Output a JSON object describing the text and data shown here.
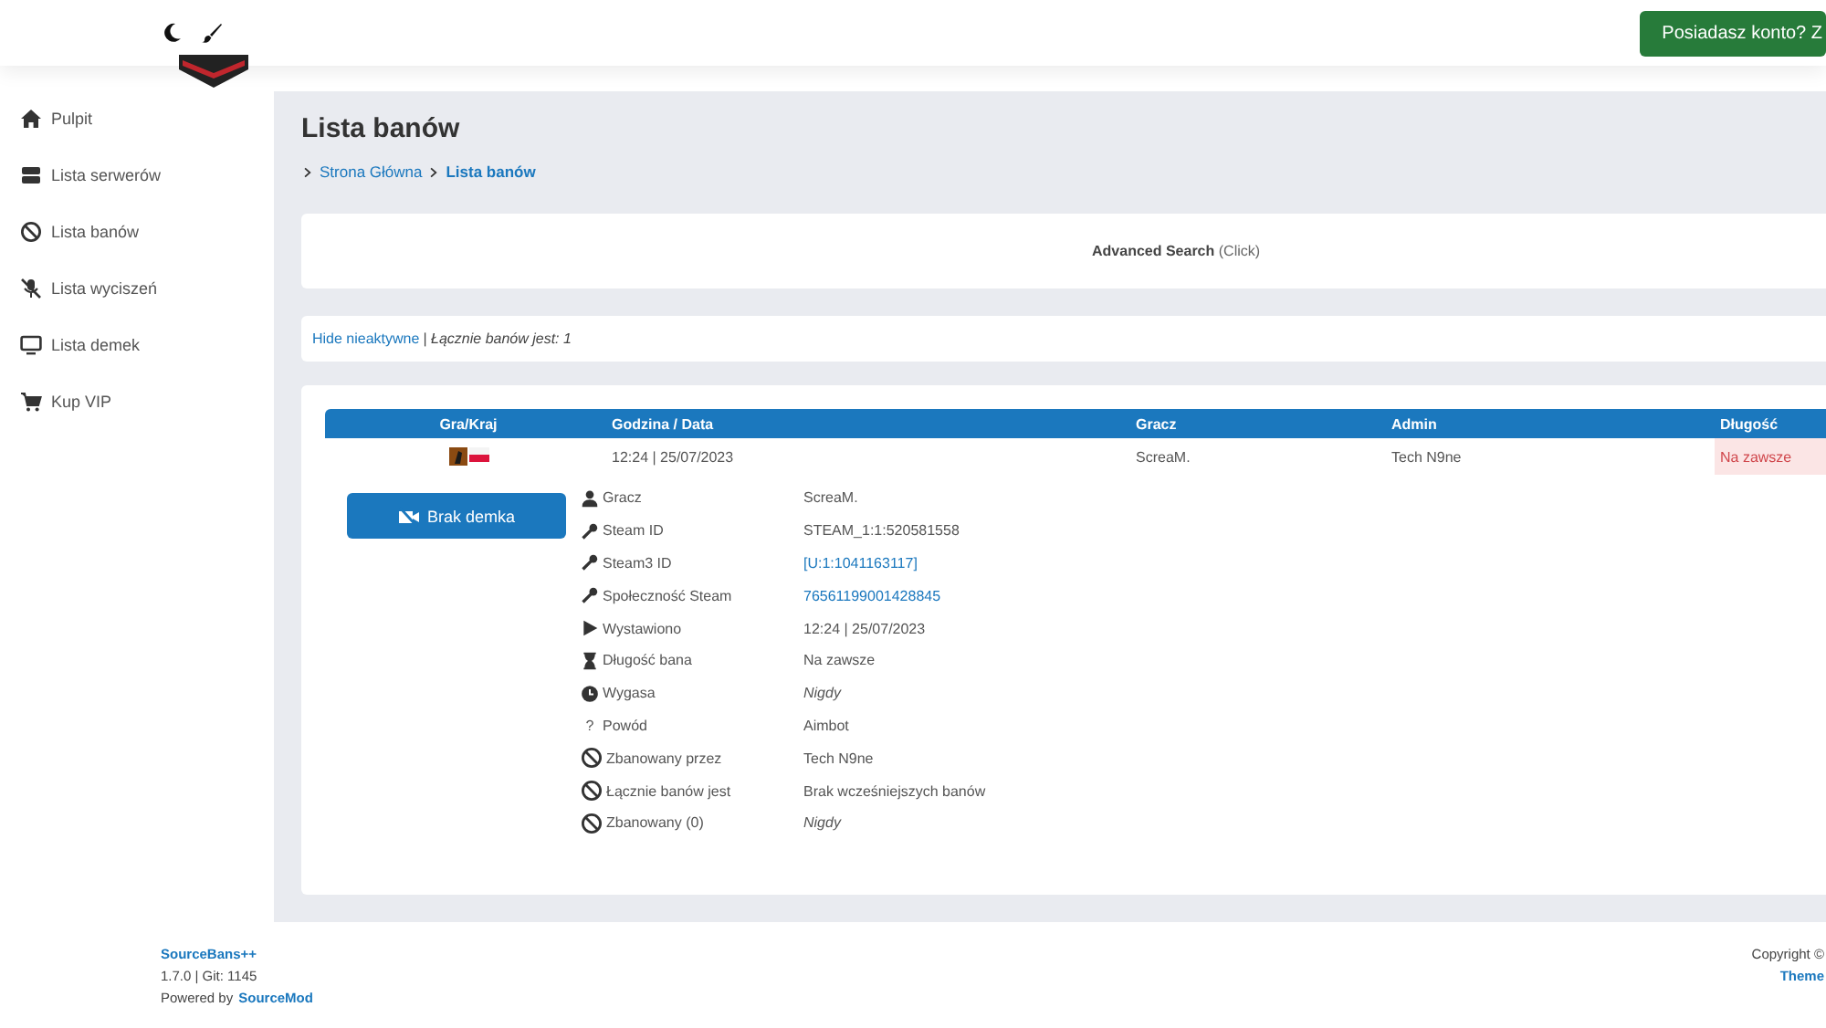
{
  "header": {
    "login_button": "Posiadasz konto? Z"
  },
  "sidebar": {
    "items": [
      {
        "label": "Pulpit"
      },
      {
        "label": "Lista serwerów"
      },
      {
        "label": "Lista banów"
      },
      {
        "label": "Lista wyciszeń"
      },
      {
        "label": "Lista demek"
      },
      {
        "label": "Kup VIP"
      }
    ]
  },
  "page_title": "Lista banów",
  "breadcrumb": [
    {
      "label": "Strona Główna",
      "current": false
    },
    {
      "label": "Lista banów",
      "current": true
    }
  ],
  "advanced_search": {
    "title": "Advanced Search",
    "hint": "(Click)"
  },
  "filter": {
    "link": "Hide nieaktywne",
    "separator": "|",
    "summary": "Łącznie banów jest: 1"
  },
  "table": {
    "columns": [
      "Gra/Kraj",
      "Godzina / Data",
      "Gracz",
      "Admin",
      "Długość"
    ],
    "rows": [
      {
        "time": "12:24 | 25/07/2023",
        "player": "ScreaM.",
        "admin": "Tech N9ne",
        "length": "Na zawsze",
        "expanded": true,
        "details": {
          "demo_button": "Brak demka",
          "fields": [
            {
              "label": "Gracz",
              "value": "ScreaM.",
              "kind": "text"
            },
            {
              "label": "Steam ID",
              "value": "STEAM_1:1:520581558",
              "kind": "text"
            },
            {
              "label": "Steam3 ID",
              "value": "[U:1:1041163117]",
              "kind": "link"
            },
            {
              "label": "Społeczność Steam",
              "value": "76561199001428845",
              "kind": "link"
            },
            {
              "label": "Wystawiono",
              "value": "12:24 | 25/07/2023",
              "kind": "text"
            },
            {
              "label": "Długość bana",
              "value": "Na zawsze",
              "kind": "text"
            },
            {
              "label": "Wygasa",
              "value": "Nigdy",
              "kind": "italic"
            },
            {
              "icon": "?",
              "label": "Powód",
              "value": "Aimbot",
              "kind": "text"
            },
            {
              "label": "Zbanowany przez",
              "value": "Tech N9ne",
              "kind": "text"
            },
            {
              "label": "Łącznie banów jest",
              "value": "Brak wcześniejszych banów",
              "kind": "text"
            },
            {
              "label": "Zbanowany (0)",
              "value": "Nigdy",
              "kind": "italic"
            }
          ]
        }
      }
    ]
  },
  "footer": {
    "app": "SourceBans++",
    "version": "1.7.0 | Git: 1145",
    "powered_prefix": "Powered by",
    "powered_link": "SourceMod",
    "copyright": "Copyright ©",
    "theme": "Theme"
  }
}
